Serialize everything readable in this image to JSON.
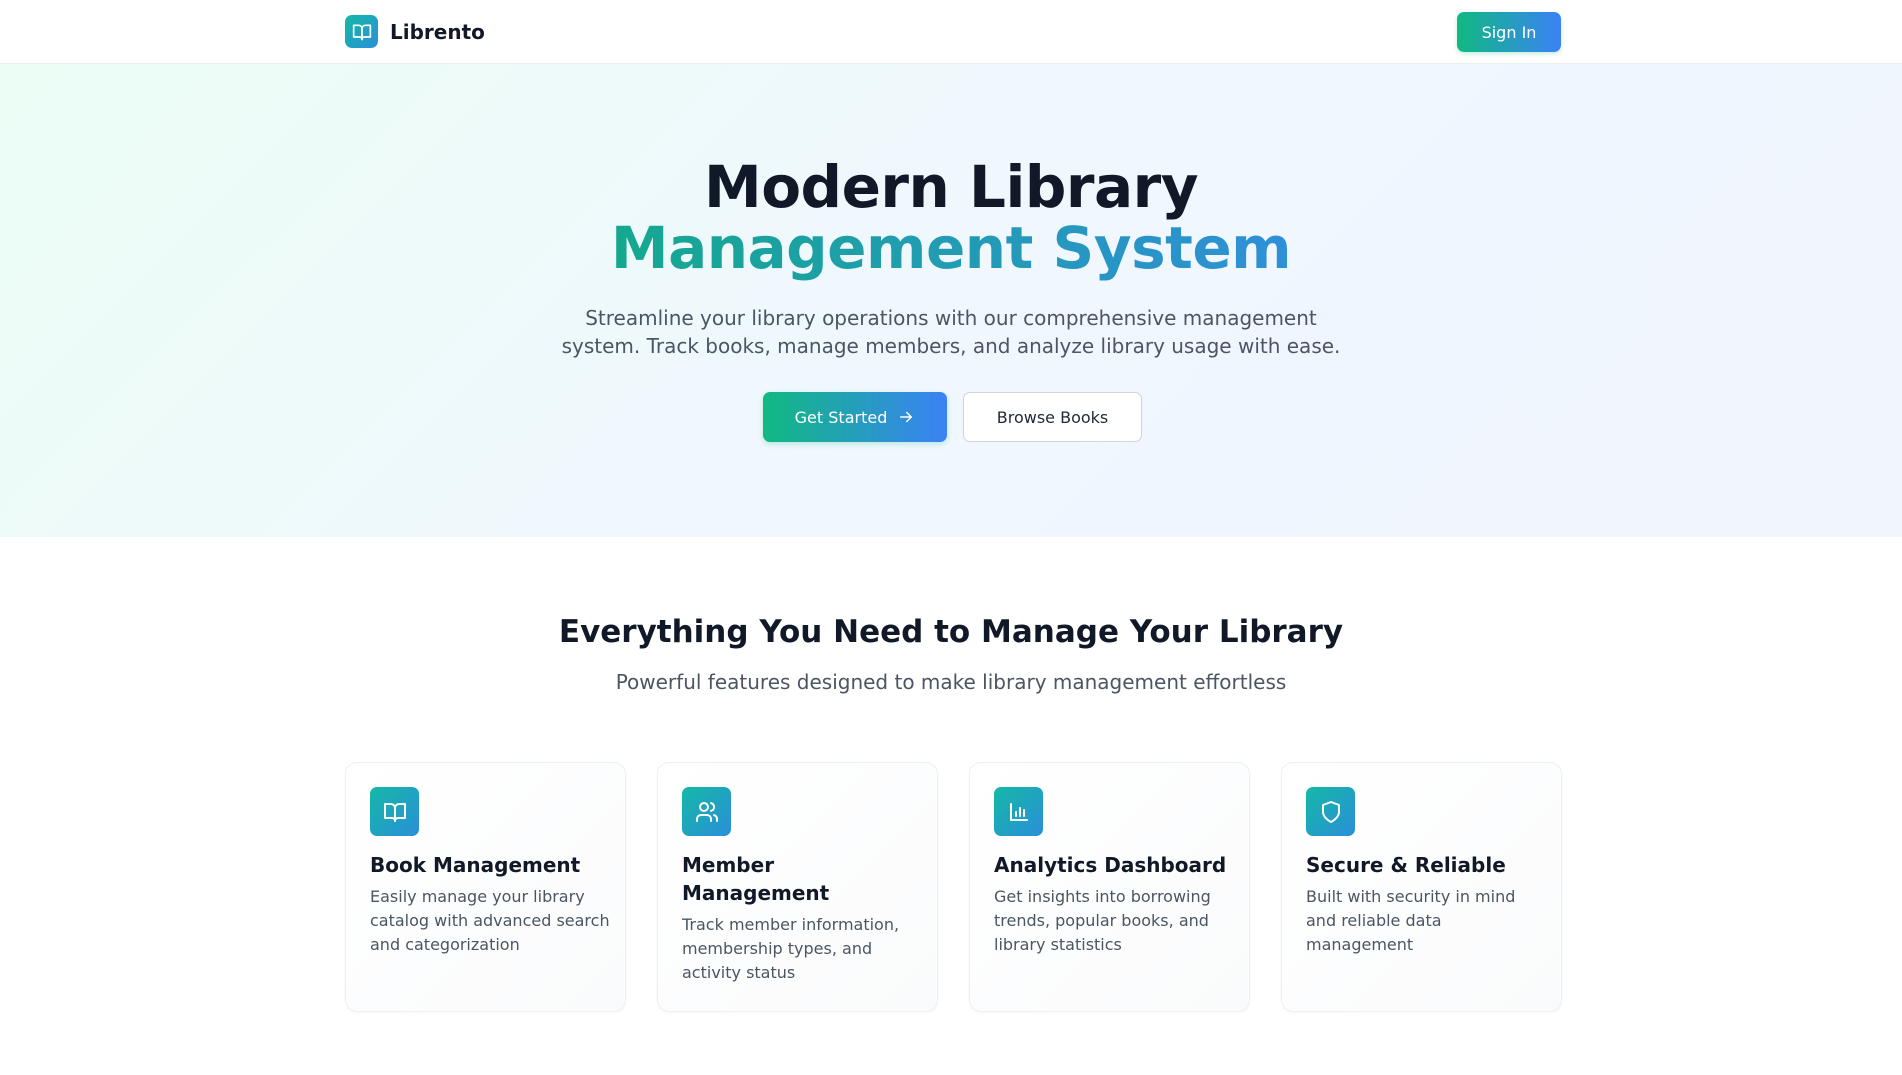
{
  "nav": {
    "brand_name": "Librento",
    "signin_label": "Sign In"
  },
  "hero": {
    "title_line1": "Modern Library",
    "title_line2": "Management System",
    "subtitle": "Streamline your library operations with our comprehensive management system. Track books, manage members, and analyze library usage with ease.",
    "primary_cta": "Get Started",
    "secondary_cta": "Browse Books"
  },
  "features": {
    "heading": "Everything You Need to Manage Your Library",
    "subheading": "Powerful features designed to make library management effortless",
    "cards": [
      {
        "icon": "book-open-icon",
        "title": "Book Management",
        "description": "Easily manage your library catalog with advanced search and categorization"
      },
      {
        "icon": "users-icon",
        "title": "Member Management",
        "description": "Track member information, membership types, and activity status"
      },
      {
        "icon": "bar-chart-icon",
        "title": "Analytics Dashboard",
        "description": "Get insights into borrowing trends, popular books, and library statistics"
      },
      {
        "icon": "shield-icon",
        "title": "Secure & Reliable",
        "description": "Built with security in mind and reliable data management"
      }
    ]
  },
  "colors": {
    "accent_start": "#10b981",
    "accent_end": "#3b82f6",
    "heading": "#111827",
    "body_text": "#4b5563"
  }
}
